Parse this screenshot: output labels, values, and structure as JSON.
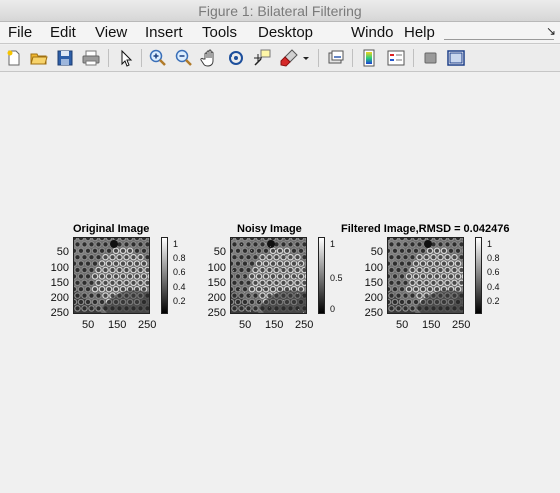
{
  "window": {
    "title": "Figure 1: Bilateral Filtering"
  },
  "menubar": {
    "items": [
      {
        "label": "File"
      },
      {
        "label": "Edit"
      },
      {
        "label": "View"
      },
      {
        "label": "Insert"
      },
      {
        "label": "Tools"
      },
      {
        "label": "Desktop"
      },
      {
        "label": "Windo"
      },
      {
        "label": "Help"
      }
    ],
    "overflow_arrow": "↘"
  },
  "toolbar": {
    "icons": [
      "new-figure-icon",
      "open-file-icon",
      "save-icon",
      "print-icon",
      "pointer-icon",
      "zoom-in-icon",
      "zoom-out-icon",
      "pan-hand-icon",
      "rotate-3d-icon",
      "data-cursor-icon",
      "brush-icon",
      "brush-dropdown-icon",
      "link-plot-icon",
      "colorbar-icon",
      "legend-icon",
      "hide-plot-tools-icon",
      "show-plot-tools-icon"
    ]
  },
  "figures": [
    {
      "title": "Original Image",
      "yticks": [
        "50",
        "100",
        "150",
        "200",
        "250"
      ],
      "xticks": [
        "50",
        "150",
        "250"
      ],
      "colorbar_ticks": [
        "1",
        "0.8",
        "0.6",
        "0.4",
        "0.2"
      ],
      "noise": false
    },
    {
      "title": "Noisy Image",
      "yticks": [
        "50",
        "100",
        "150",
        "200",
        "250"
      ],
      "xticks": [
        "50",
        "150",
        "250"
      ],
      "colorbar_ticks": [
        "1",
        "0.5",
        "0"
      ],
      "noise": true
    },
    {
      "title": "Filtered Image,RMSD = 0.042476",
      "yticks": [
        "50",
        "100",
        "150",
        "200",
        "250"
      ],
      "xticks": [
        "50",
        "150",
        "250"
      ],
      "colorbar_ticks": [
        "1",
        "0.8",
        "0.6",
        "0.4",
        "0.2"
      ],
      "noise": false
    }
  ],
  "colormap": "gray"
}
